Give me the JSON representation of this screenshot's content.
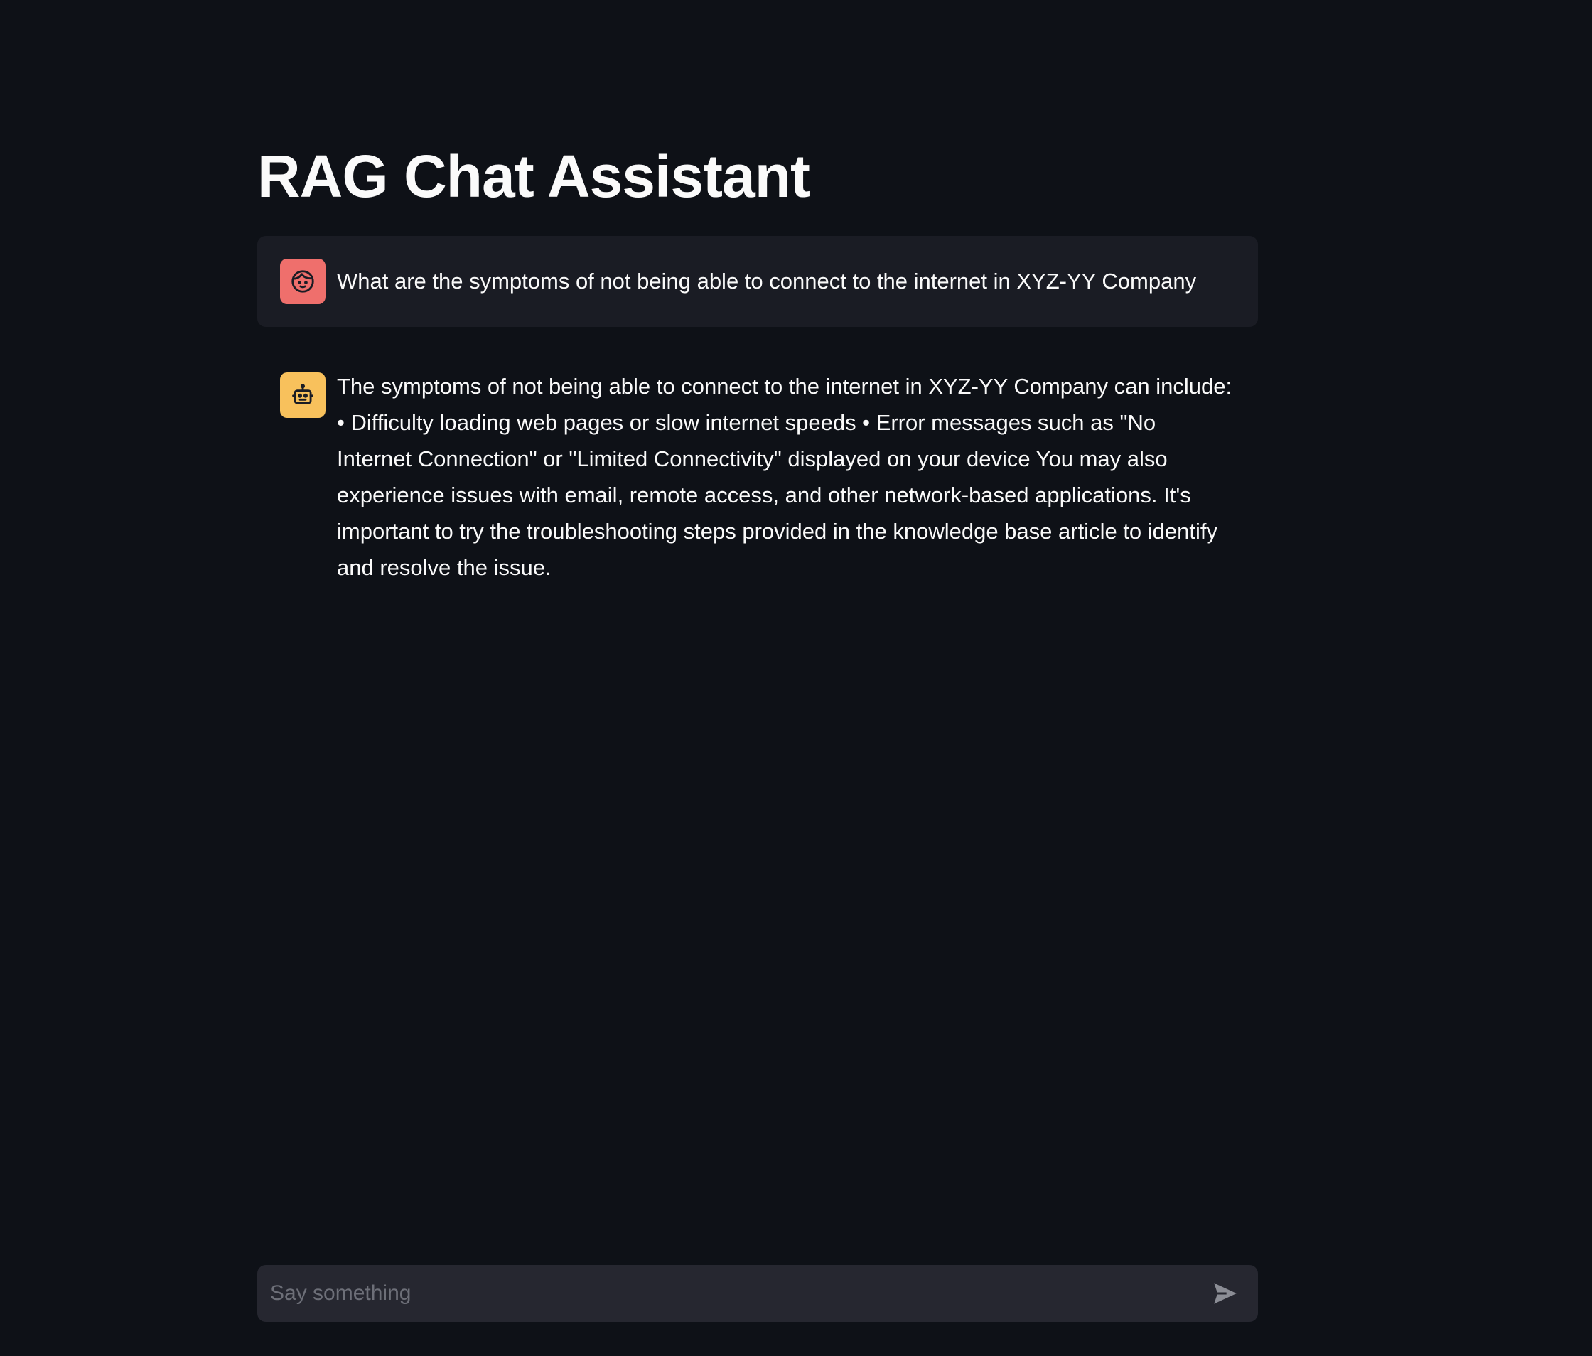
{
  "page": {
    "title": "RAG Chat Assistant"
  },
  "messages": [
    {
      "role": "user",
      "avatar_icon": "user-face-icon",
      "text": "What are the symptoms of not being able to connect to the internet in XYZ-YY Company"
    },
    {
      "role": "assistant",
      "avatar_icon": "robot-icon",
      "text": "The symptoms of not being able to connect to the internet in XYZ-YY Company can include: • Difficulty loading web pages or slow internet speeds • Error messages such as \"No Internet Connection\" or \"Limited Connectivity\" displayed on your device You may also experience issues with email, remote access, and other network-based applications. It's important to try the troubleshooting steps provided in the knowledge base article to identify and resolve the issue."
    }
  ],
  "chat_input": {
    "placeholder": "Say something",
    "value": "",
    "send_icon": "send-icon"
  },
  "colors": {
    "background": "#0e1117",
    "user_message_bg": "#1a1c24",
    "user_avatar": "#ef6f6c",
    "assistant_avatar": "#f8c15c",
    "input_bg": "#262730",
    "text": "#fafafa"
  }
}
